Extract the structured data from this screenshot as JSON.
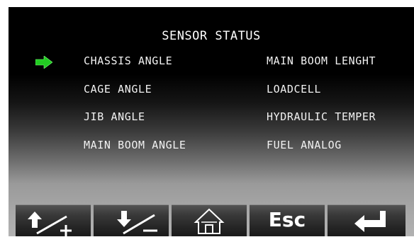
{
  "header": {
    "title": "SENSOR STATUS"
  },
  "sensors": {
    "left": [
      "CHASSIS ANGLE",
      "CAGE ANGLE",
      "JIB ANGLE",
      "MAIN BOOM ANGLE"
    ],
    "right": [
      "MAIN BOOM LENGHT",
      "LOADCELL",
      "HYDRAULIC TEMPER",
      "FUEL ANALOG"
    ]
  },
  "selection": {
    "selected_item": "CHASSIS ANGLE",
    "indicator_icon": "green-right-arrow-icon",
    "indicator_color": "#22cc22"
  },
  "toolbar": {
    "buttons": [
      {
        "icon": "arrow-up-plus-icon"
      },
      {
        "icon": "arrow-down-minus-icon"
      },
      {
        "icon": "home-icon"
      },
      {
        "label": "Esc"
      },
      {
        "icon": "enter-return-icon"
      }
    ]
  },
  "colors": {
    "screen_top": "#000000",
    "screen_bottom": "#b2b2b2",
    "text": "#f2f2f2",
    "button": "#2a2a2a"
  }
}
